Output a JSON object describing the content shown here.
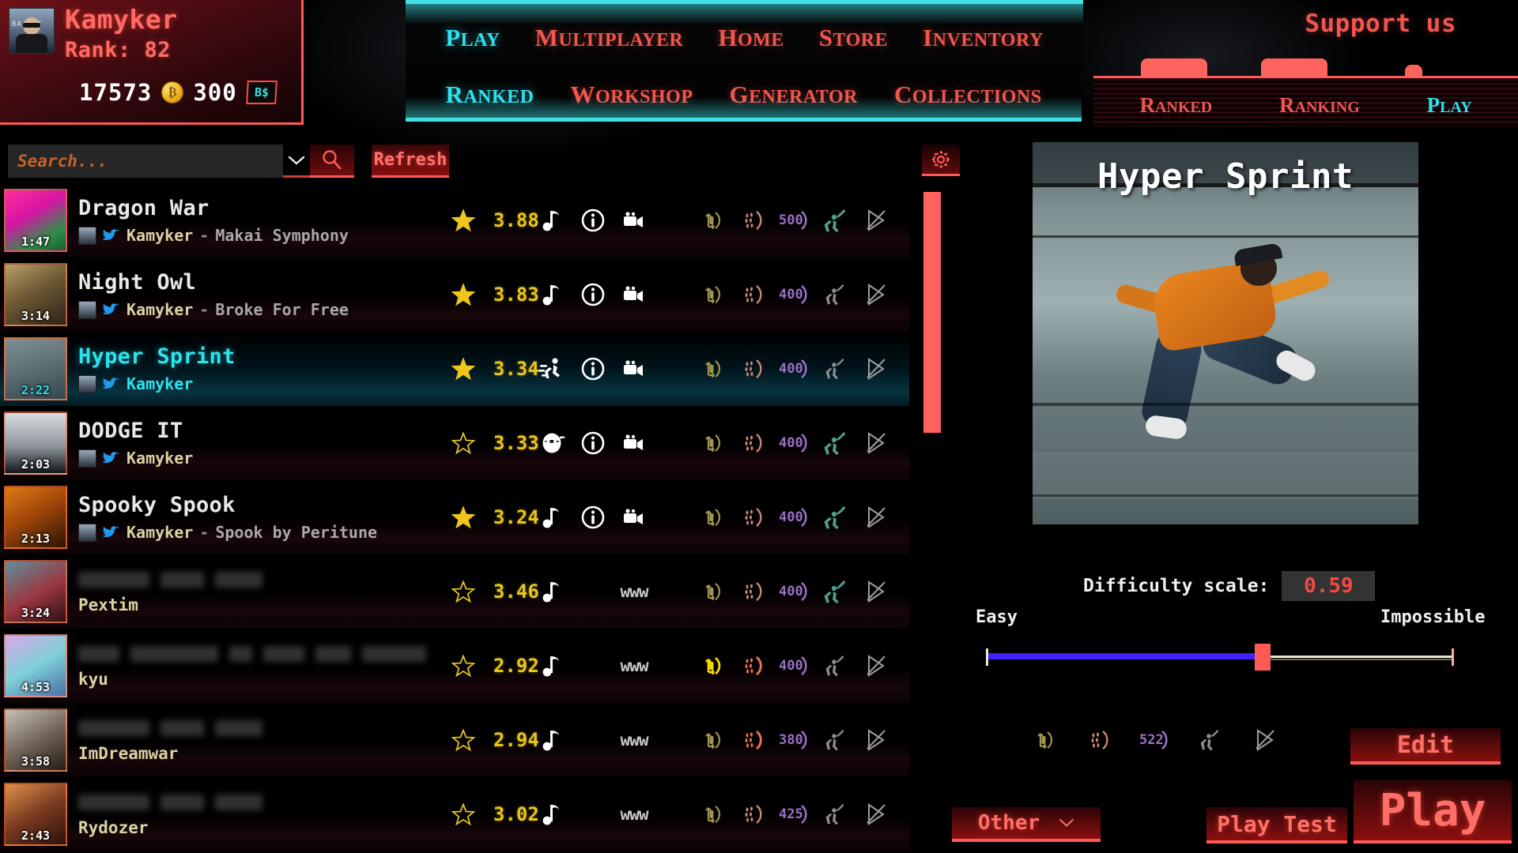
{
  "player": {
    "name": "Kamyker",
    "rank_label": "Rank: 82",
    "coins": "17573",
    "premium": "300",
    "premium_badge": "B$",
    "avatar_text": "BA  FFI"
  },
  "nav_primary": [
    {
      "label": "Play",
      "active": true
    },
    {
      "label": "Multiplayer",
      "active": false
    },
    {
      "label": "Home",
      "active": false
    },
    {
      "label": "Store",
      "active": false
    },
    {
      "label": "Inventory",
      "active": false
    }
  ],
  "nav_secondary": [
    {
      "label": "Ranked",
      "active": true
    },
    {
      "label": "Workshop",
      "active": false
    },
    {
      "label": "Generator",
      "active": false
    },
    {
      "label": "Collections",
      "active": false
    }
  ],
  "support_label": "Support us",
  "nav_right": [
    {
      "label": "Ranked",
      "active": false
    },
    {
      "label": "Ranking",
      "active": false
    },
    {
      "label": "Play",
      "active": true
    }
  ],
  "search": {
    "placeholder": "Search...",
    "value": "",
    "refresh_label": "Refresh"
  },
  "songs": [
    {
      "title": "Dragon War",
      "blurred": false,
      "duration": "1:47",
      "author": "Kamyker",
      "song_name": "Makai Symphony",
      "dash": "-",
      "rating": "3.88",
      "star_filled": true,
      "type_icon": "music-note-icon",
      "has_info": true,
      "has_video": true,
      "www": false,
      "count": "500",
      "dancer": true,
      "dancer_color": "#4f9e8c",
      "rot_bright": false,
      "dots_bright": false,
      "thumb": "linear-gradient(150deg,#ff2f9a,#d615a5 40%,#2f8f4a 75%,#1a5c30)"
    },
    {
      "title": "Night Owl",
      "blurred": false,
      "duration": "3:14",
      "author": "Kamyker",
      "song_name": "Broke For Free",
      "dash": "-",
      "rating": "3.83",
      "star_filled": true,
      "type_icon": "music-note-icon",
      "has_info": true,
      "has_video": true,
      "www": false,
      "count": "400",
      "dancer": false,
      "dancer_color": "#8d8d8d",
      "rot_bright": false,
      "dots_bright": false,
      "thumb": "linear-gradient(150deg,#b8a06a,#6e5a34 45%,#2b2318)"
    },
    {
      "title": "Hyper Sprint",
      "blurred": false,
      "duration": "2:22",
      "author": "Kamyker",
      "song_name": "",
      "dash": "",
      "rating": "3.34",
      "star_filled": true,
      "selected": true,
      "type_icon": "runner-icon",
      "has_info": true,
      "has_video": true,
      "www": false,
      "count": "400",
      "dancer": false,
      "dancer_color": "#8d8d8d",
      "rot_bright": false,
      "dots_bright": false,
      "thumb": "linear-gradient(165deg,#7f9094,#5d6e73 50%,#33464d)"
    },
    {
      "title": "DODGE IT",
      "blurred": false,
      "duration": "2:03",
      "author": "Kamyker",
      "song_name": "",
      "dash": "",
      "rating": "3.33",
      "star_filled": false,
      "type_icon": "ninja-face-icon",
      "has_info": true,
      "has_video": true,
      "www": false,
      "count": "400",
      "dancer": true,
      "dancer_color": "#4f9e8c",
      "rot_bright": false,
      "dots_bright": false,
      "thumb": "linear-gradient(180deg,#d8dde2,#8e959c 55%,#14161a)"
    },
    {
      "title": "Spooky Spook",
      "blurred": false,
      "duration": "2:13",
      "author": "Kamyker",
      "song_name": "Spook by Peritune",
      "dash": "-",
      "rating": "3.24",
      "star_filled": true,
      "type_icon": "music-note-icon",
      "has_info": true,
      "has_video": true,
      "www": false,
      "count": "400",
      "dancer": true,
      "dancer_color": "#4f9e8c",
      "rot_bright": false,
      "dots_bright": false,
      "thumb": "linear-gradient(150deg,#e07a16,#a2470a 45%,#2a1405)"
    },
    {
      "title": "",
      "blurred": true,
      "duration": "3:24",
      "author": "Pextim",
      "song_name": "",
      "dash": "",
      "rating": "3.46",
      "star_filled": false,
      "type_icon": "music-note-icon",
      "has_info": false,
      "has_video": false,
      "www": true,
      "count": "400",
      "dancer": true,
      "dancer_color": "#4f9e8c",
      "rot_bright": false,
      "dots_bright": false,
      "thumb": "linear-gradient(150deg,#5f8f9a,#9a3640 55%,#2a1015)"
    },
    {
      "title": "",
      "blurred": true,
      "duration": "4:53",
      "author": "kyu",
      "song_name": "",
      "dash": "",
      "rating": "2.92",
      "star_filled": false,
      "type_icon": "music-note-icon",
      "has_info": false,
      "has_video": false,
      "www": true,
      "count": "400",
      "dancer": false,
      "dancer_color": "#8d8d8d",
      "rot_bright": true,
      "dots_bright": true,
      "thumb": "linear-gradient(150deg,#dba8e8,#7fd0d8 50%,#4a6fa8)"
    },
    {
      "title": "",
      "blurred": true,
      "duration": "3:58",
      "author": "ImDreamwar",
      "song_name": "",
      "dash": "",
      "rating": "2.94",
      "star_filled": false,
      "type_icon": "music-note-icon",
      "has_info": false,
      "has_video": false,
      "www": true,
      "count": "380",
      "dancer": false,
      "dancer_color": "#8d8d8d",
      "rot_bright": false,
      "dots_bright": true,
      "thumb": "linear-gradient(150deg,#c8c0b4,#6b5f52 55%,#241d16)"
    },
    {
      "title": "",
      "blurred": true,
      "duration": "2:43",
      "author": "Rydozer",
      "song_name": "",
      "dash": "",
      "rating": "3.02",
      "star_filled": false,
      "type_icon": "music-note-icon",
      "has_info": false,
      "has_video": false,
      "www": true,
      "count": "425",
      "dancer": false,
      "dancer_color": "#8d8d8d",
      "rot_bright": false,
      "dots_bright": false,
      "thumb": "linear-gradient(150deg,#e0904a,#7a3a20 50%,#2a1209)"
    }
  ],
  "preview": {
    "title": "Hyper Sprint"
  },
  "difficulty": {
    "label": "Difficulty scale:",
    "value": "0.59",
    "min_label": "Easy",
    "max_label": "Impossible"
  },
  "detail_count": "522",
  "buttons": {
    "edit": "Edit",
    "other": "Other",
    "play_test": "Play Test",
    "play": "Play"
  }
}
